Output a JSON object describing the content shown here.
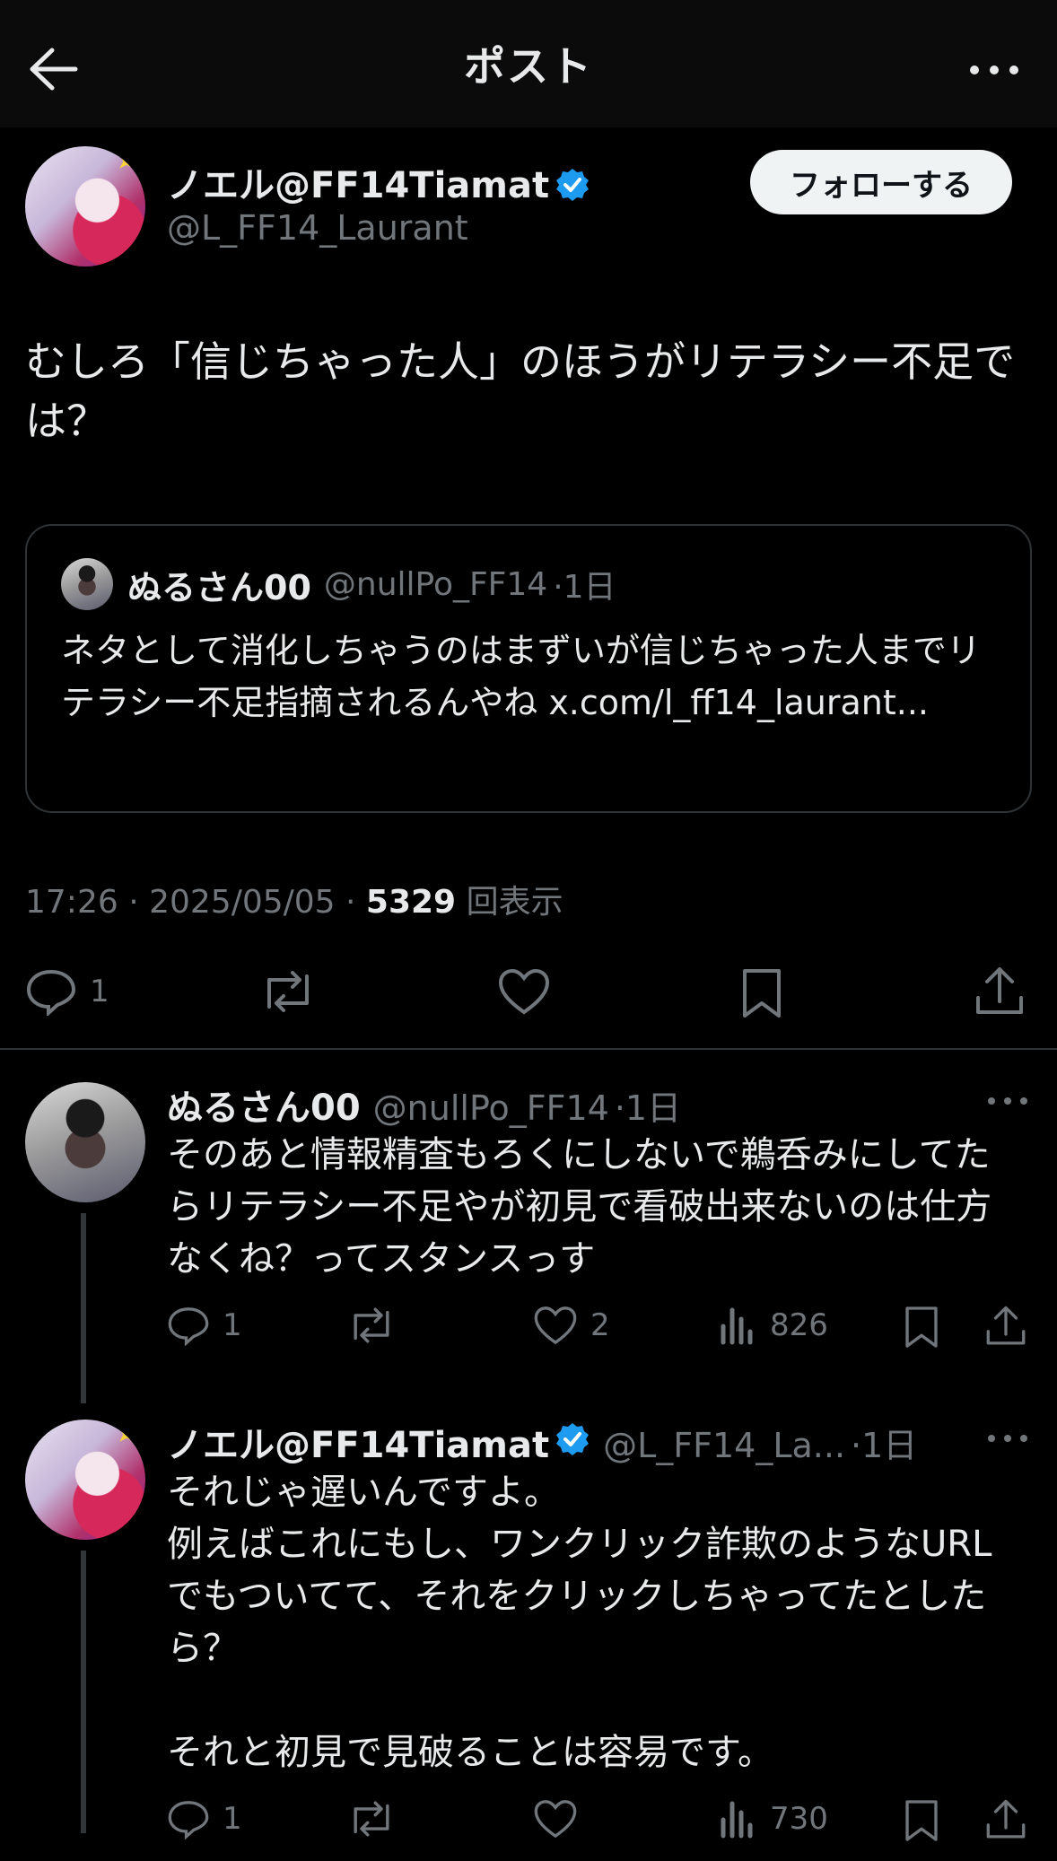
{
  "header": {
    "title": "ポスト"
  },
  "main_post": {
    "author_name": "ノエル@FF14Tiamat",
    "author_handle": "@L_FF14_Laurant",
    "follow_label": "フォローする",
    "text": "むしろ「信じちゃった人」のほうがリテラシー不足では？",
    "quote": {
      "author_name": "ぬるさん00",
      "author_handle": "@nullPo_FF14",
      "time": "·1日",
      "text": "ネタとして消化しちゃうのはまずいが信じちゃった人までリテラシー不足指摘されるんやね x.com/l_ff14_laurant..."
    },
    "timestamp": "17:26 · 2025/05/05 · ",
    "views_count": "5329",
    "views_label": "回表示",
    "reply_count": "1"
  },
  "replies": [
    {
      "author_name": "ぬるさん00",
      "author_handle": "@nullPo_FF14",
      "time": "·1日",
      "text": "そのあと情報精査もろくにしないで鵜呑みにしてたらリテラシー不足やが初見で看破出来ないのは仕方なくね？ってスタンスっす",
      "reply_count": "1",
      "like_count": "2",
      "view_count": "826"
    },
    {
      "author_name": "ノエル@FF14Tiamat",
      "author_handle": "@L_FF14_La...",
      "time": "·1日",
      "text": "それじゃ遅いんですよ。\n例えばこれにもし、ワンクリック詐欺のようなURLでもついてて、それをクリックしちゃってたとしたら？\n\nそれと初見で見破ることは容易です。",
      "reply_count": "1",
      "view_count": "730"
    }
  ],
  "colors": {
    "background": "#000000",
    "verified": "#1d9bf0",
    "muted": "#71767b",
    "text": "#e7e9ea"
  },
  "icons": [
    "back-arrow-icon",
    "more-icon",
    "verified-badge-icon",
    "reply-icon",
    "repost-icon",
    "like-icon",
    "views-icon",
    "bookmark-icon",
    "share-icon"
  ]
}
